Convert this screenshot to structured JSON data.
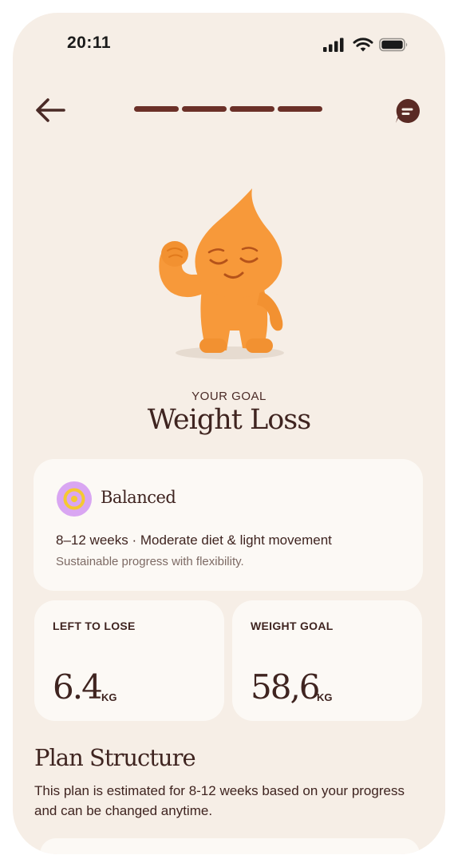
{
  "status_bar": {
    "time": "20:11"
  },
  "header": {
    "back_icon": "arrow-left-icon",
    "chat_icon": "chat-bubble-icon",
    "progress_steps": 4,
    "progress_completed": 4
  },
  "goal": {
    "label": "YOUR GOAL",
    "title": "Weight Loss"
  },
  "plan_option": {
    "icon": "target-icon",
    "title": "Balanced",
    "duration": "8–12 weeks",
    "separator": "·",
    "approach": "Moderate diet & light movement",
    "description": "Sustainable progress with flexibility."
  },
  "stats": {
    "left_to_lose": {
      "label": "LEFT TO LOSE",
      "value": "6.4",
      "unit": "KG"
    },
    "weight_goal": {
      "label": "WEIGHT GOAL",
      "value": "58,6",
      "unit": "KG"
    }
  },
  "plan_structure": {
    "title": "Plan Structure",
    "description": "This plan is estimated for 8-12 weeks based on your progress and can be changed anytime."
  },
  "colors": {
    "background": "#f6eee6",
    "card": "#fcf9f5",
    "accent_dark": "#6b3028",
    "mascot": "#f7993a",
    "icon_bg": "#d9a6f2",
    "icon_ring": "#f5c932"
  }
}
